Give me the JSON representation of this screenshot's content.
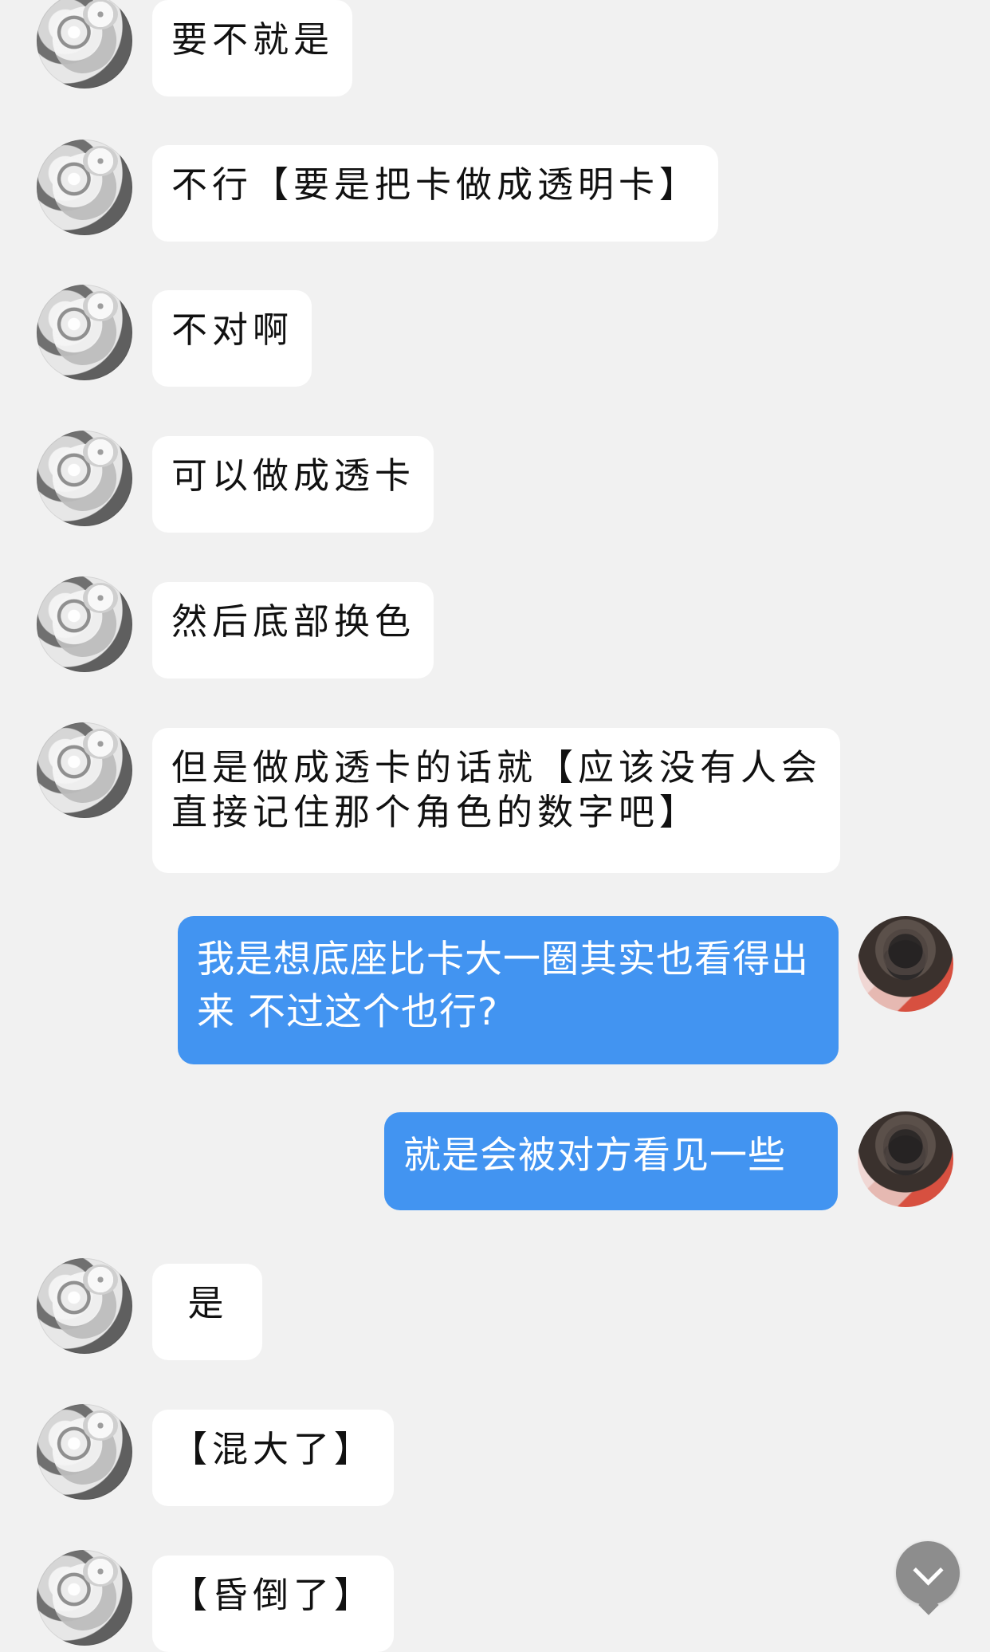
{
  "conversation": {
    "messages": [
      {
        "side": "left",
        "text": "要不就是"
      },
      {
        "side": "left",
        "text": "不行【要是把卡做成透明卡】"
      },
      {
        "side": "left",
        "text": "不对啊"
      },
      {
        "side": "left",
        "text": "可以做成透卡"
      },
      {
        "side": "left",
        "text": "然后底部换色"
      },
      {
        "side": "left",
        "text": "但是做成透卡的话就【应该没有人会直接记住那个角色的数字吧】"
      },
      {
        "side": "right",
        "text": "我是想底座比卡大一圈其实也看得出来 不过这个也行?"
      },
      {
        "side": "right",
        "text": "就是会被对方看见一些"
      },
      {
        "side": "left",
        "text": "是"
      },
      {
        "side": "left",
        "text": "【混大了】"
      },
      {
        "side": "left",
        "text": "【昏倒了】"
      }
    ]
  },
  "icons": {
    "avatar_left": "snow-leopard-avatar",
    "avatar_right": "black-cat-avatar",
    "scroll_button": "chevron-down-icon"
  },
  "colors": {
    "background": "#f1f1f1",
    "incoming_bubble": "#ffffff",
    "outgoing_bubble": "#4294f1",
    "outgoing_text": "#ffffff",
    "scroll_button": "#8d8d8d"
  }
}
